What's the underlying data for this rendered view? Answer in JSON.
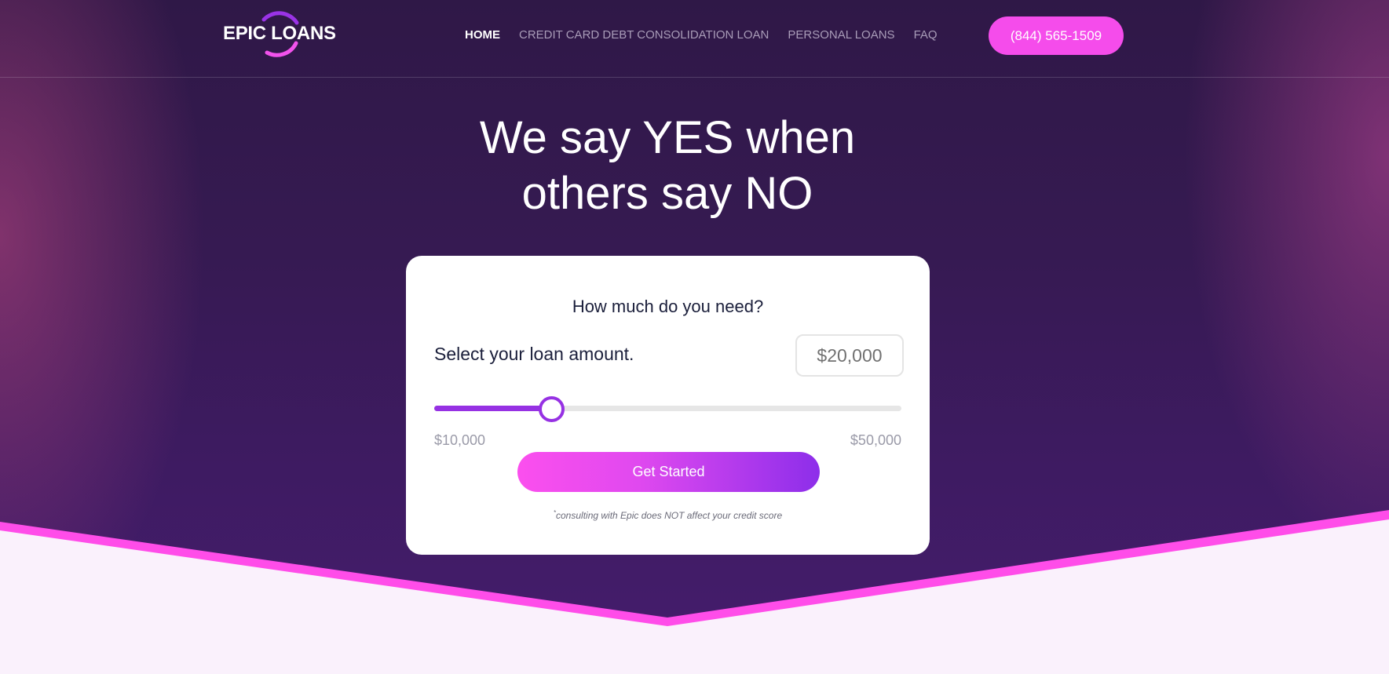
{
  "brand": {
    "logo_text": "EPIC LOANS"
  },
  "nav": {
    "items": [
      {
        "label": "HOME",
        "active": true
      },
      {
        "label": "CREDIT CARD DEBT CONSOLIDATION LOAN",
        "active": false
      },
      {
        "label": "PERSONAL LOANS",
        "active": false
      },
      {
        "label": "FAQ",
        "active": false
      }
    ],
    "phone": "(844) 565-1509"
  },
  "hero": {
    "headline_line1": "We say YES when",
    "headline_line2": "others say NO"
  },
  "loan_form": {
    "title": "How much do you need?",
    "label": "Select your loan amount.",
    "amount_value": "$20,000",
    "slider": {
      "min": 10000,
      "max": 50000,
      "value": 20000,
      "min_label": "$10,000",
      "max_label": "$50,000"
    },
    "cta_label": "Get Started",
    "disclaimer_mark": "*",
    "disclaimer": "consulting with Epic does NOT affect your credit score"
  },
  "colors": {
    "accent_pink": "#f54ceb",
    "accent_purple": "#9631e3",
    "hero_bg": "#361a52",
    "page_bg": "#faf1fc"
  }
}
